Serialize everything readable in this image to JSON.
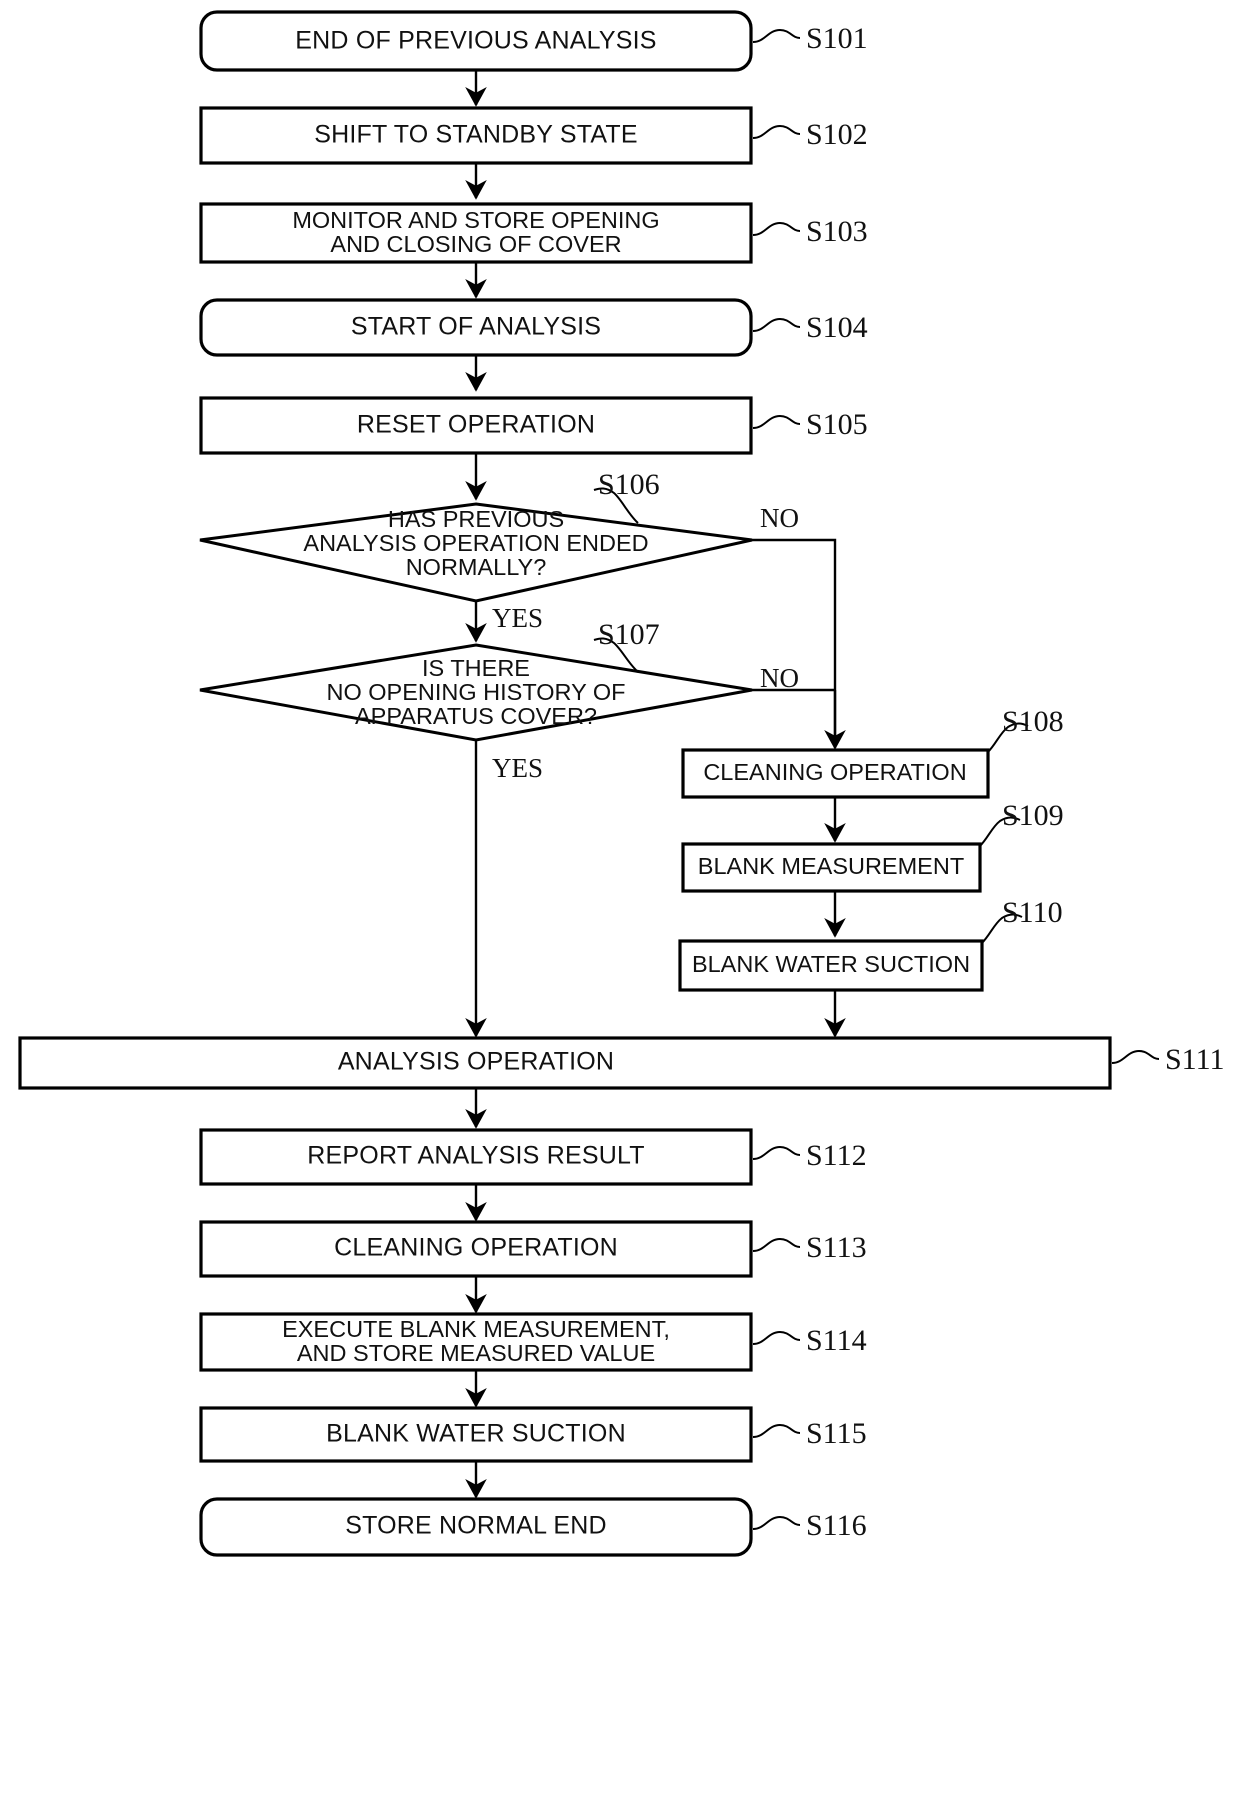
{
  "diagram": {
    "type": "flowchart",
    "title": "Analysis apparatus operation flowchart",
    "orientation": "top-to-bottom",
    "nodes": [
      {
        "id": "S101",
        "label": "END OF PREVIOUS ANALYSIS",
        "shape": "rounded-rectangle",
        "step": "S101"
      },
      {
        "id": "S102",
        "label": "SHIFT TO STANDBY STATE",
        "shape": "rectangle",
        "step": "S102"
      },
      {
        "id": "S103",
        "label_line1": "MONITOR AND STORE OPENING",
        "label_line2": "AND CLOSING OF COVER",
        "shape": "rectangle",
        "step": "S103"
      },
      {
        "id": "S104",
        "label": "START OF ANALYSIS",
        "shape": "rounded-rectangle",
        "step": "S104"
      },
      {
        "id": "S105",
        "label": "RESET OPERATION",
        "shape": "rectangle",
        "step": "S105"
      },
      {
        "id": "S106",
        "label_line1": "HAS PREVIOUS",
        "label_line2": "ANALYSIS OPERATION ENDED",
        "label_line3": "NORMALLY?",
        "shape": "diamond",
        "step": "S106"
      },
      {
        "id": "S107",
        "label_line1": "IS THERE",
        "label_line2": "NO OPENING HISTORY OF",
        "label_line3": "APPARATUS COVER?",
        "shape": "diamond",
        "step": "S107"
      },
      {
        "id": "S108",
        "label": "CLEANING OPERATION",
        "shape": "rectangle",
        "step": "S108"
      },
      {
        "id": "S109",
        "label": "BLANK MEASUREMENT",
        "shape": "rectangle",
        "step": "S109"
      },
      {
        "id": "S110",
        "label": "BLANK WATER SUCTION",
        "shape": "rectangle",
        "step": "S110"
      },
      {
        "id": "S111",
        "label": "ANALYSIS OPERATION",
        "shape": "rectangle-wide",
        "step": "S111"
      },
      {
        "id": "S112",
        "label": "REPORT ANALYSIS RESULT",
        "shape": "rectangle",
        "step": "S112"
      },
      {
        "id": "S113",
        "label": "CLEANING OPERATION",
        "shape": "rectangle",
        "step": "S113"
      },
      {
        "id": "S114",
        "label_line1": "EXECUTE BLANK MEASUREMENT,",
        "label_line2": "AND STORE MEASURED VALUE",
        "shape": "rectangle",
        "step": "S114"
      },
      {
        "id": "S115",
        "label": "BLANK WATER SUCTION",
        "shape": "rectangle",
        "step": "S115"
      },
      {
        "id": "S116",
        "label": "STORE NORMAL END",
        "shape": "rounded-rectangle",
        "step": "S116"
      }
    ],
    "branch_labels": {
      "s106_no": "NO",
      "s106_yes": "YES",
      "s107_no": "NO",
      "s107_yes": "YES"
    },
    "edges": [
      {
        "from": "S101",
        "to": "S102"
      },
      {
        "from": "S102",
        "to": "S103"
      },
      {
        "from": "S103",
        "to": "S104"
      },
      {
        "from": "S104",
        "to": "S105"
      },
      {
        "from": "S105",
        "to": "S106"
      },
      {
        "from": "S106",
        "to": "S107",
        "label": "YES"
      },
      {
        "from": "S106",
        "to": "S108",
        "label": "NO"
      },
      {
        "from": "S107",
        "to": "S111",
        "label": "YES"
      },
      {
        "from": "S107",
        "to": "S108",
        "label": "NO"
      },
      {
        "from": "S108",
        "to": "S109"
      },
      {
        "from": "S109",
        "to": "S110"
      },
      {
        "from": "S110",
        "to": "S111"
      },
      {
        "from": "S111",
        "to": "S112"
      },
      {
        "from": "S112",
        "to": "S113"
      },
      {
        "from": "S113",
        "to": "S114"
      },
      {
        "from": "S114",
        "to": "S115"
      },
      {
        "from": "S115",
        "to": "S116"
      }
    ],
    "colors": {
      "stroke": "#000000",
      "fill": "#ffffff",
      "text": "#111111"
    }
  }
}
